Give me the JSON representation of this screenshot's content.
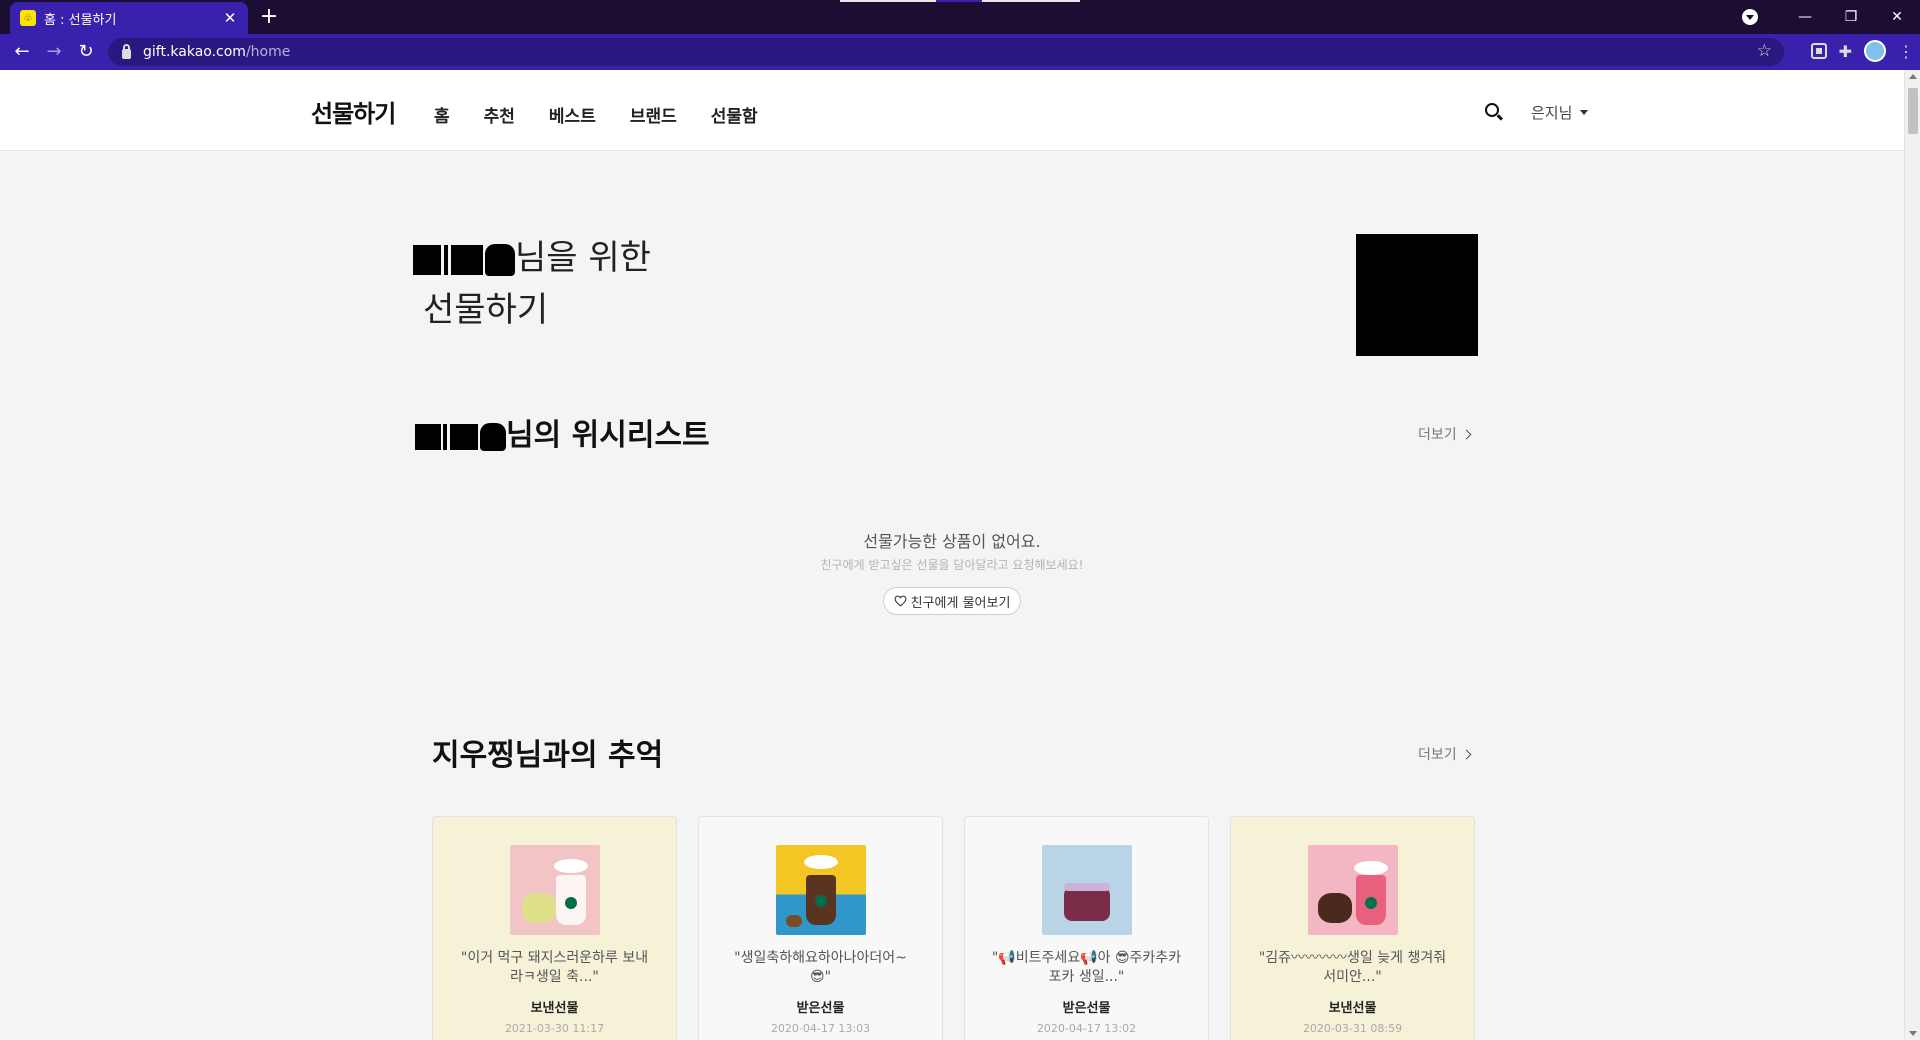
{
  "browser": {
    "tab_title": "홈 : 선물하기",
    "tab_favicon": "gift-favicon",
    "url_domain": "gift.kakao.com",
    "url_path": "/home",
    "colors": {
      "frame": "#1c0e32",
      "toolbar": "#3a21ad"
    }
  },
  "header": {
    "logo": "선물하기",
    "nav": [
      "홈",
      "추천",
      "베스트",
      "브랜드",
      "선물함"
    ],
    "active_nav": "홈",
    "user_name": "은지님"
  },
  "hero": {
    "line1_suffix": "님을 위한",
    "line2": "선물하기"
  },
  "wishlist": {
    "title_suffix": "님의 위시리스트",
    "more_label": "더보기",
    "empty_main": "선물가능한 상품이 없어요.",
    "empty_sub": "친구에게 받고싶은 선물을 담아달라고 요청해보세요!",
    "ask_button": "친구에게 물어보기"
  },
  "memories": {
    "title": "지우찡님과의 추억",
    "more_label": "더보기",
    "cards": [
      {
        "message": "\"이거 먹구 돼지스러운하루 보내라ㅋ생일 축...\"",
        "type": "보낸선물",
        "date": "2021-03-30 11:17"
      },
      {
        "message": "\"생일축하해요하아나아더어~😎\"",
        "type": "받은선물",
        "date": "2020-04-17 13:03"
      },
      {
        "message": "\"📢비트주세요📢아 😎주카추카포카 생일...\"",
        "type": "받은선물",
        "date": "2020-04-17 13:02"
      },
      {
        "message": "\"김쥬〰〰〰〰생일 늦게 챙겨줘서미안...\"",
        "type": "보낸선물",
        "date": "2020-03-31 08:59"
      }
    ]
  },
  "colors": {
    "accent": "#fee500",
    "sent_card": "#f6f2d8",
    "received_card": "#f8f8f8"
  }
}
